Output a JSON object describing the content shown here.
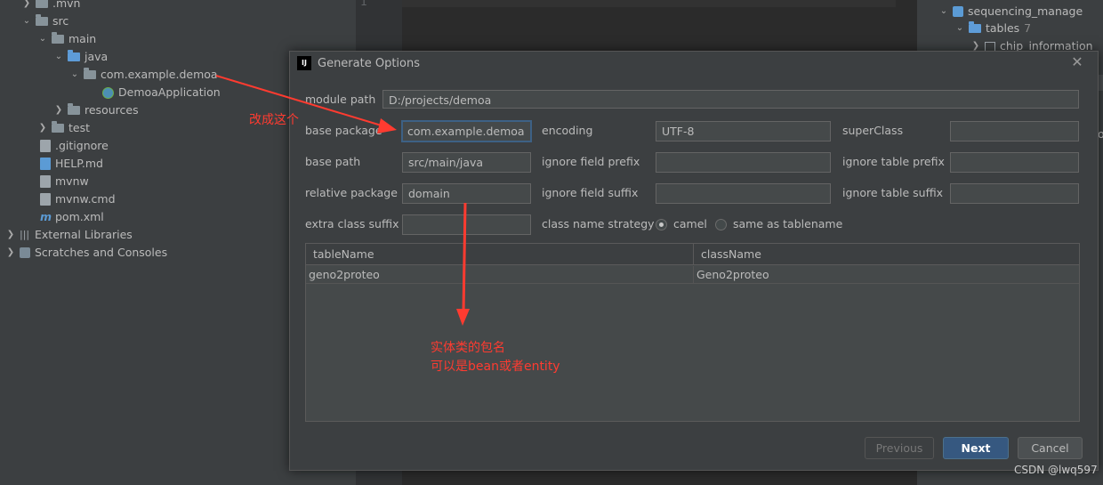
{
  "project_tree": [
    {
      "label": ".mvn"
    },
    {
      "label": "src"
    },
    {
      "label": "main"
    },
    {
      "label": "java"
    },
    {
      "label": "com.example.demoa"
    },
    {
      "label": "DemoaApplication"
    },
    {
      "label": "resources"
    },
    {
      "label": "test"
    },
    {
      "label": ".gitignore"
    },
    {
      "label": "HELP.md"
    },
    {
      "label": "mvnw"
    },
    {
      "label": "mvnw.cmd"
    },
    {
      "label": "pom.xml"
    },
    {
      "label": "External Libraries"
    },
    {
      "label": "Scratches and Consoles"
    }
  ],
  "editor": {
    "line_number": "1"
  },
  "db_panel": {
    "schema": "sequencing_manage",
    "tables_label": "tables",
    "tables_count": "7",
    "table_item": "chip_information",
    "fragment": "o"
  },
  "dialog": {
    "title": "Generate Options",
    "logo": "IJ",
    "close": "✕",
    "module_path_label": "module path",
    "module_path_value": "D:/projects/demoa",
    "base_package_label": "base package",
    "base_package_value": "com.example.demoa",
    "encoding_label": "encoding",
    "encoding_value": "UTF-8",
    "superclass_label": "superClass",
    "superclass_value": "",
    "base_path_label": "base path",
    "base_path_value": "src/main/java",
    "ignore_field_prefix_label": "ignore field prefix",
    "ignore_field_prefix_value": "",
    "ignore_table_prefix_label": "ignore table prefix",
    "ignore_table_prefix_value": "",
    "relative_package_label": "relative package",
    "relative_package_value": "domain",
    "ignore_field_suffix_label": "ignore field suffix",
    "ignore_field_suffix_value": "",
    "ignore_table_suffix_label": "ignore table suffix",
    "ignore_table_suffix_value": "",
    "extra_class_suffix_label": "extra class suffix",
    "extra_class_suffix_value": "",
    "class_name_strategy_label": "class name strategy",
    "strategy_options": [
      "camel",
      "same as tablename"
    ],
    "strategy_selected": "camel",
    "table": {
      "columns": [
        "tableName",
        "className"
      ],
      "rows": [
        [
          "geno2proteo",
          "Geno2proteo"
        ]
      ]
    },
    "buttons": {
      "previous": "Previous",
      "next": "Next",
      "cancel": "Cancel"
    }
  },
  "annotations": {
    "change_this": "改成这个",
    "entity_package_line1": "实体类的包名",
    "entity_package_line2": "可以是bean或者entity"
  },
  "colors": {
    "annotation": "#ff3b30",
    "primary_button": "#365880",
    "focus_border": "#3d6185"
  },
  "watermark": "CSDN @lwq597"
}
